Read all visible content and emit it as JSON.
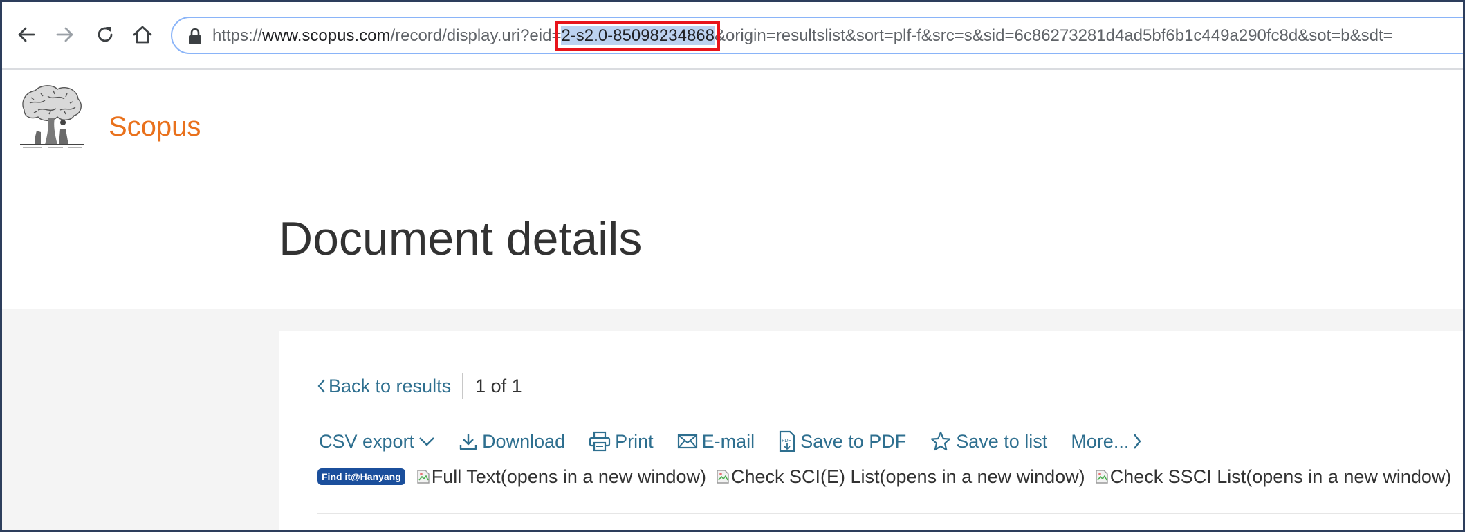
{
  "browser": {
    "url": {
      "prefix": "https://",
      "host": "www.scopus.com",
      "path_before": "/record/display.uri?eid=",
      "selected": "2-s2.0-85098234868",
      "path_after": "&origin=resultslist&sort=plf-f&src=s&sid=6c86273281d4ad5bf6b1c449a290fc8d&sot=b&sdt="
    },
    "icons": [
      "back-arrow-icon",
      "forward-arrow-icon",
      "reload-icon",
      "home-icon",
      "lock-icon"
    ],
    "highlight_color": "#e8141b",
    "selection_color": "#bcd2f0"
  },
  "header": {
    "brand": "Scopus",
    "brand_color": "#e9711c",
    "logo": "elsevier-tree-logo"
  },
  "main": {
    "title": "Document details",
    "back_link": "Back to results",
    "pager": "1 of 1",
    "actions": {
      "csv_export": "CSV export",
      "download": "Download",
      "print": "Print",
      "email": "E-mail",
      "save_pdf": "Save to PDF",
      "save_list": "Save to list",
      "more": "More..."
    },
    "links": {
      "findit_badge": "Find it@Hanyang",
      "full_text": "Full Text(opens in a new window)",
      "check_scie": "Check SCI(E) List(opens in a new window)",
      "check_ssci": "Check SSCI List(opens in a new window)"
    },
    "link_color": "#2e6f8f"
  }
}
